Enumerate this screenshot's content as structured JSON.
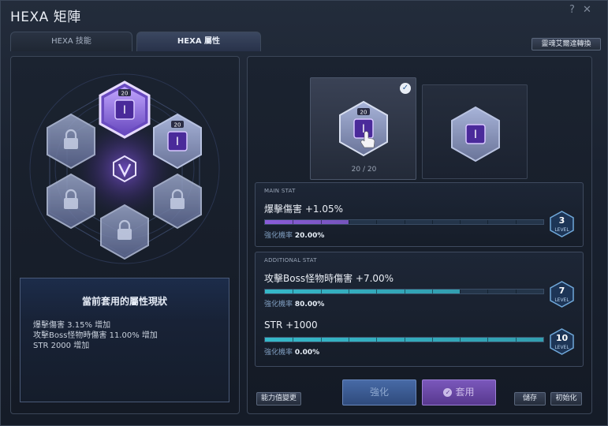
{
  "window": {
    "title": "HEXA 矩陣",
    "help_glyph": "?",
    "close_glyph": "✕"
  },
  "tabs": [
    {
      "label": "HEXA 技能",
      "active": false
    },
    {
      "label": "HEXA 屬性",
      "active": true
    }
  ],
  "top_right_button": "靈魂艾爾達轉換",
  "matrix": {
    "center_icon": "hexa-emblem-icon",
    "nodes": [
      {
        "id": "top",
        "state": "active",
        "level": "20"
      },
      {
        "id": "upper-right",
        "state": "unlocked",
        "level": "20"
      },
      {
        "id": "upper-left",
        "state": "locked"
      },
      {
        "id": "lower-left",
        "state": "locked"
      },
      {
        "id": "lower-right",
        "state": "locked"
      },
      {
        "id": "bottom",
        "state": "locked"
      }
    ]
  },
  "current_status": {
    "heading": "當前套用的屬性現狀",
    "lines": [
      "爆擊傷害 3.15% 增加",
      "攻擊Boss怪物時傷害 11.00% 增加",
      "STR 2000 增加"
    ]
  },
  "cards": [
    {
      "level": "20",
      "progress_text": "20 / 20",
      "selected": true
    },
    {
      "level": "",
      "progress_text": "",
      "selected": false
    }
  ],
  "main_stat": {
    "section_label": "MAIN STAT",
    "name": "爆擊傷害 +1.05%",
    "rate_label": "強化機率",
    "rate_value": "20.00%",
    "fill": 0.3,
    "level": "3",
    "level_word": "LEVEL"
  },
  "additional_stats": {
    "section_label": "ADDITIONAL STAT",
    "items": [
      {
        "name": "攻擊Boss怪物時傷害 +7.00%",
        "rate_label": "強化機率",
        "rate_value": "80.00%",
        "fill": 0.7,
        "level": "7",
        "level_word": "LEVEL"
      },
      {
        "name": "STR +1000",
        "rate_label": "強化機率",
        "rate_value": "0.00%",
        "fill": 1.0,
        "level": "10",
        "level_word": "LEVEL"
      }
    ]
  },
  "buttons": {
    "stat_change": "能力值變更",
    "enhance": "強化",
    "apply": "套用",
    "save": "儲存",
    "reset": "初始化"
  },
  "colors": {
    "main_fill": "#8a5cd9",
    "additional_fill": "#35b8c9",
    "apply_button": "#6b4aa8",
    "enhance_button": "#3e5f9a"
  }
}
